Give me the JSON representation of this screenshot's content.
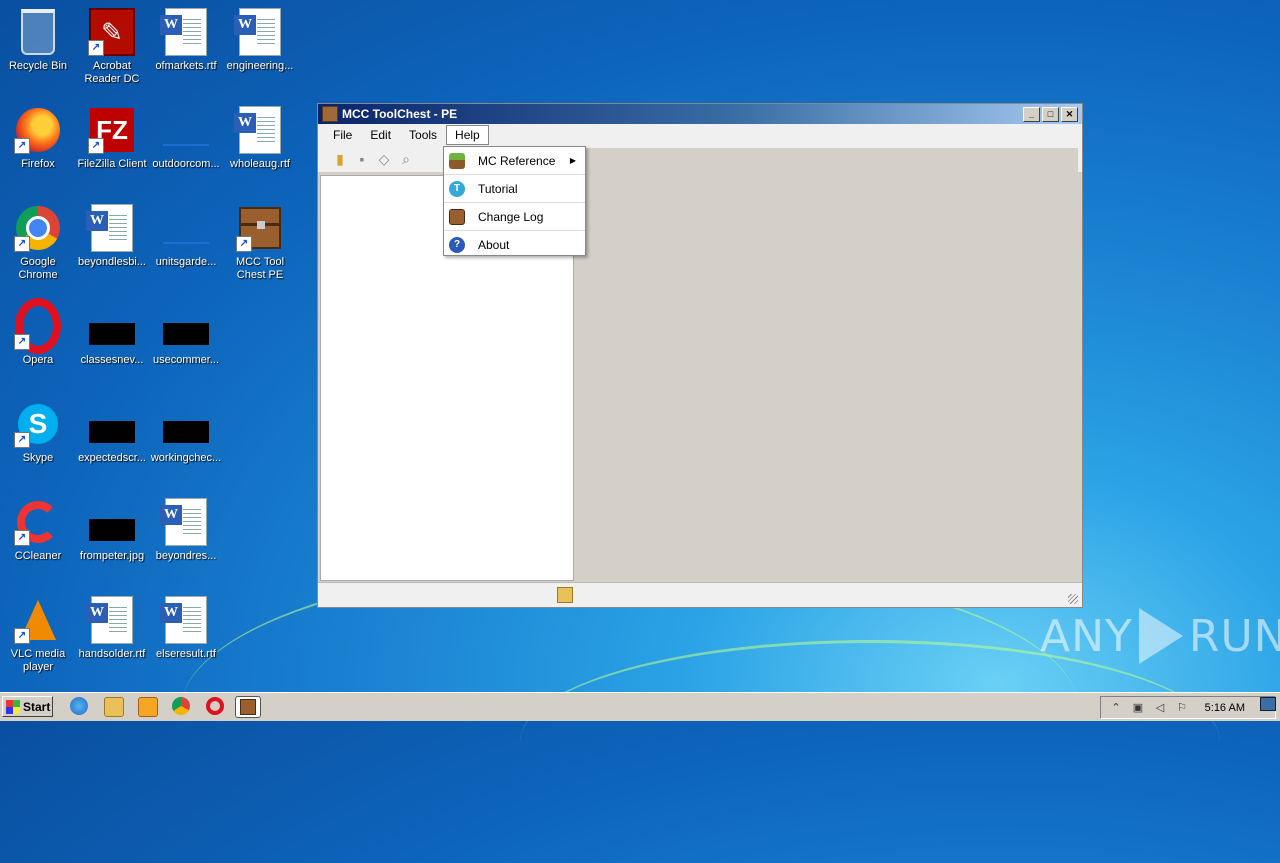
{
  "desktop": {
    "icons": [
      {
        "label": "Recycle Bin"
      },
      {
        "label": "Acrobat Reader DC"
      },
      {
        "label": "ofmarkets.rtf"
      },
      {
        "label": "engineering..."
      },
      {
        "label": "Firefox"
      },
      {
        "label": "FileZilla Client"
      },
      {
        "label": "outdoorcom..."
      },
      {
        "label": "wholeaug.rtf"
      },
      {
        "label": "Google Chrome"
      },
      {
        "label": "beyondlesbi..."
      },
      {
        "label": "unitsgarde..."
      },
      {
        "label": "MCC Tool Chest PE"
      },
      {
        "label": "Opera"
      },
      {
        "label": "classesnev..."
      },
      {
        "label": "usecommer..."
      },
      {
        "label": "Skype"
      },
      {
        "label": "expectedscr..."
      },
      {
        "label": "workingchec..."
      },
      {
        "label": "CCleaner"
      },
      {
        "label": "frompeter.jpg"
      },
      {
        "label": "beyondres..."
      },
      {
        "label": "VLC media player"
      },
      {
        "label": "handsolder.rtf"
      },
      {
        "label": "elseresult.rtf"
      }
    ]
  },
  "window": {
    "title": "MCC ToolChest - PE",
    "menu": [
      "File",
      "Edit",
      "Tools",
      "Help"
    ],
    "open_menu": "Help",
    "help_menu": [
      {
        "label": "MC Reference",
        "icon": "cube-icon",
        "submenu": true
      },
      {
        "label": "Tutorial",
        "icon": "tutorial-icon",
        "submenu": false
      },
      {
        "label": "Change Log",
        "icon": "chest-icon",
        "submenu": false
      },
      {
        "label": "About",
        "icon": "help-icon",
        "submenu": false
      }
    ]
  },
  "taskbar": {
    "start_label": "Start",
    "clock": "5:16 AM"
  },
  "watermark": {
    "left": "ANY",
    "right": "RUN"
  }
}
